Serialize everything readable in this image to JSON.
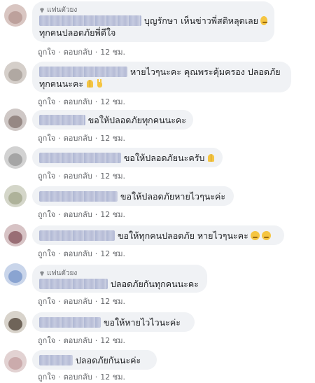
{
  "fan_badge": "แฟนตัวยง",
  "actions": {
    "like": "ถูกใจ",
    "reply": "ตอบกลับ",
    "time": "12 ชม."
  },
  "comments": [
    {
      "badge": true,
      "lines": [
        "บุญรักษา เห็นข่าวพี่สติหลุดเลย",
        "ทุกคนปลอดภัยพี่ดีใจ"
      ]
    },
    {
      "badge": false,
      "lines": [
        "หายไวๆนะคะ คุณพระคุ้มครอง ปลอดภัย",
        "ทุกคนนะคะ"
      ]
    },
    {
      "badge": false,
      "lines": [
        "ขอให้ปลอดภัยทุกคนนะคะ"
      ]
    },
    {
      "badge": false,
      "lines": [
        "ขอให้ปลอดภัยนะครับ"
      ]
    },
    {
      "badge": false,
      "lines": [
        "ขอให้ปลอดภัยหายไวๆนะค่ะ"
      ]
    },
    {
      "badge": false,
      "lines": [
        "ขอให้ทุกคนปลอดภัย หายไวๆนะคะ"
      ]
    },
    {
      "badge": true,
      "lines": [
        "ปลอดภัยกันทุกคนนะคะ"
      ]
    },
    {
      "badge": false,
      "lines": [
        "ขอให้หายไวไวนะค่ะ"
      ]
    },
    {
      "badge": false,
      "lines": [
        "ปลอดภัยกันนะค่ะ"
      ]
    }
  ]
}
